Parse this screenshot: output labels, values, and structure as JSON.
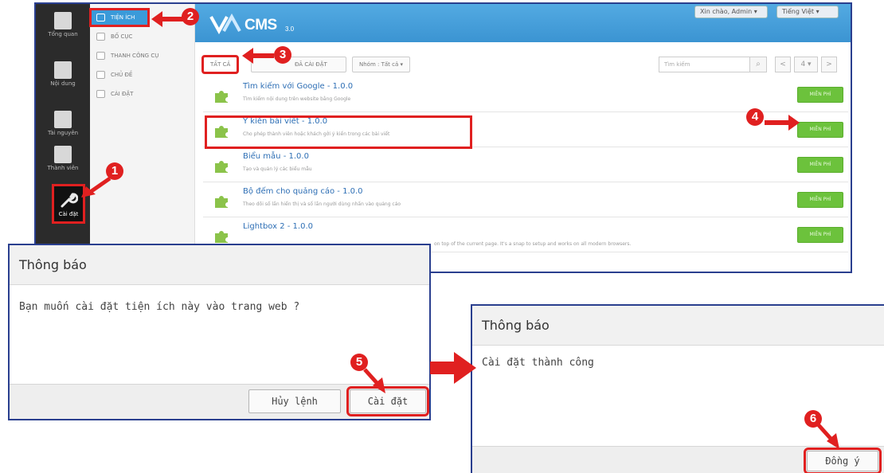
{
  "rail": {
    "items": [
      {
        "label": "Tổng quan"
      },
      {
        "label": "Nội dung"
      },
      {
        "label": "Tài nguyên"
      },
      {
        "label": "Thành viên"
      },
      {
        "label": "Cài đặt"
      }
    ]
  },
  "submenu": {
    "items": [
      {
        "label": "TIỆN ÍCH"
      },
      {
        "label": "BỐ CỤC"
      },
      {
        "label": "THANH CÔNG CỤ"
      },
      {
        "label": "CHỦ ĐỀ"
      },
      {
        "label": "CÀI ĐẶT"
      }
    ]
  },
  "header": {
    "logo_text": "CMS",
    "logo_version": "3.0",
    "user_dropdown": "Xin chào, Admin",
    "language_dropdown": "Tiếng Việt"
  },
  "toolbar": {
    "all_tab": "TẤT CẢ",
    "installed_tab": "ĐÃ CÀI ĐẶT",
    "group_filter": "Nhóm : Tất cả",
    "search_placeholder": "Tìm kiếm",
    "prev_label": "<",
    "page_label": "4",
    "next_label": ">"
  },
  "plugins": [
    {
      "name": "Tìm kiếm với Google - 1.0.0",
      "desc": "Tìm kiếm nội dung trên website bằng Google",
      "button": "MIỄN PHÍ"
    },
    {
      "name": "Ý kiến bài viết - 1.0.0",
      "desc": "Cho phép thành viên hoặc khách gởi ý kiến trong các bài viết",
      "button": "MIỄN PHÍ"
    },
    {
      "name": "Biểu mẫu - 1.0.0",
      "desc": "Tạo và quản lý các biểu mẫu",
      "button": "MIỄN PHÍ"
    },
    {
      "name": "Bộ đếm cho quảng cáo - 1.0.0",
      "desc": "Theo dõi số lần hiển thị và số lần người dùng nhấn vào quảng cáo",
      "button": "MIỄN PHÍ"
    },
    {
      "name": "Lightbox 2 - 1.0.0",
      "desc": "on top of the current page. It's a snap to setup and works on all modern browsers.",
      "button": "MIỄN PHÍ"
    }
  ],
  "dialog_confirm": {
    "title": "Thông báo",
    "message": "Bạn muốn cài đặt tiện ích này vào trang web ?",
    "cancel_label": "Hủy lệnh",
    "install_label": "Cài đặt"
  },
  "dialog_success": {
    "title": "Thông báo",
    "message": "Cài đặt thành công",
    "ok_label": "Đồng ý"
  },
  "steps": [
    "1",
    "2",
    "3",
    "4",
    "5",
    "6"
  ],
  "colors": {
    "accent_red": "#e02020",
    "header_blue": "#3b94d2",
    "free_green": "#6cc23c",
    "frame_navy": "#2a3f8f"
  }
}
